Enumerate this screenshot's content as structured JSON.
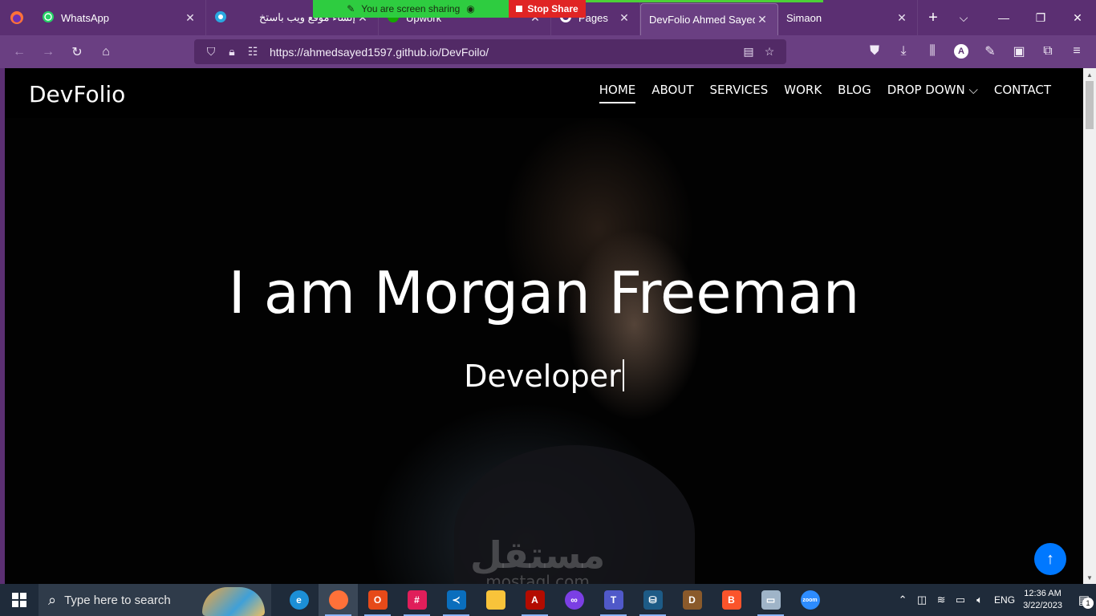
{
  "browser": {
    "tabs": [
      {
        "label": "WhatsApp",
        "icon": "whatsapp-icon"
      },
      {
        "label": "إنشاء موقع ويب باستخ",
        "icon": "globe-icon"
      },
      {
        "label": "Upwork",
        "icon": "upwork-icon"
      },
      {
        "label": "Pages",
        "icon": "github-icon"
      },
      {
        "label": "DevFolio Ahmed Sayed",
        "icon": "page-icon",
        "active": true
      },
      {
        "label": "Simaon",
        "icon": "page-icon"
      }
    ],
    "screen_share": {
      "status": "You are screen sharing",
      "stop_label": "Stop Share"
    },
    "url": "https://ahmedsayed1597.github.io/DevFoilo/",
    "colors": {
      "chrome": "#5b2f72",
      "toolbar": "#6a3f82",
      "share_green": "#2ecc40",
      "share_red": "#e02424"
    }
  },
  "site": {
    "logo": "DevFolio",
    "menu": [
      {
        "label": "HOME",
        "active": true
      },
      {
        "label": "ABOUT"
      },
      {
        "label": "SERVICES"
      },
      {
        "label": "WORK"
      },
      {
        "label": "BLOG"
      },
      {
        "label": "DROP DOWN ⌵"
      },
      {
        "label": "CONTACT"
      }
    ],
    "hero_title": "I am Morgan Freeman",
    "hero_subtitle": "Developer",
    "back_to_top": "↑",
    "watermark_main": "مستقل",
    "watermark_sub": "mostaql.com",
    "accent": "#0078ff"
  },
  "taskbar": {
    "search_placeholder": "Type here to search",
    "apps": [
      "edge",
      "firefox",
      "office",
      "slack",
      "vscode",
      "file-explorer",
      "acrobat",
      "dolphin-anty",
      "teams",
      "mysql-workbench",
      "dbeaver",
      "brave",
      "remote-desktop",
      "zoom"
    ],
    "language": "ENG",
    "time": "12:36 AM",
    "date": "3/22/2023",
    "notification_count": "1"
  }
}
